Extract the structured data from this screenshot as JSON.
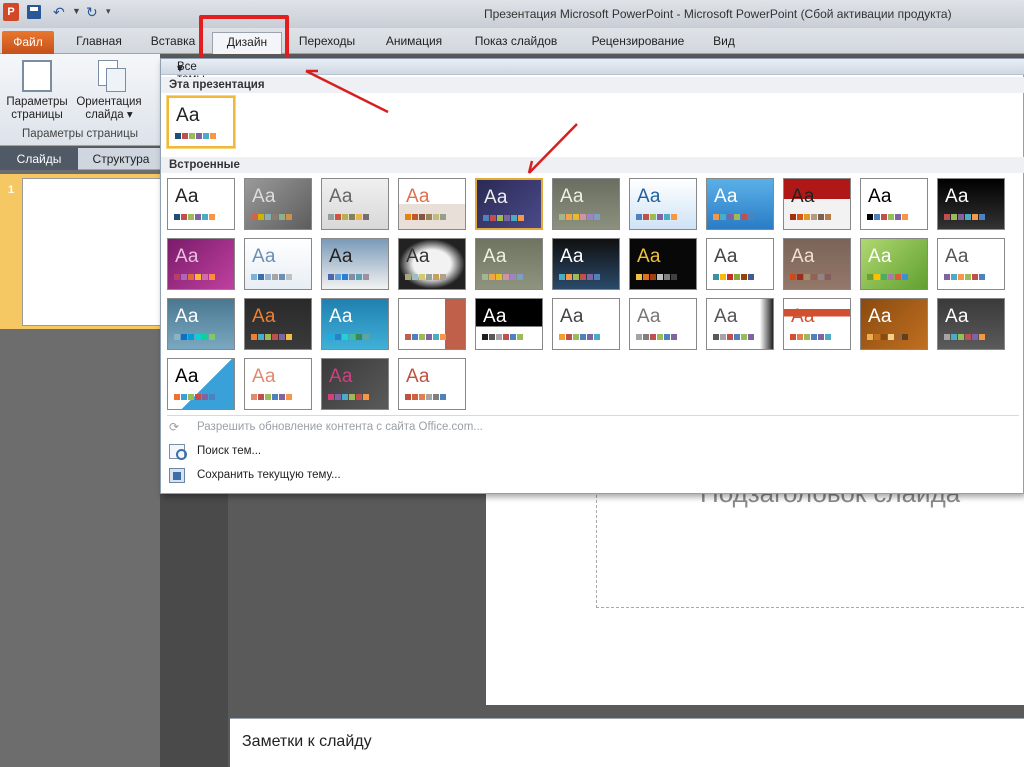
{
  "window": {
    "title": "Презентация Microsoft PowerPoint  -  Microsoft PowerPoint (Сбой активации продукта)",
    "app_icon": "P"
  },
  "tabs": [
    {
      "label": "Файл"
    },
    {
      "label": "Главная"
    },
    {
      "label": "Вставка"
    },
    {
      "label": "Дизайн"
    },
    {
      "label": "Переходы"
    },
    {
      "label": "Анимация"
    },
    {
      "label": "Показ слайдов"
    },
    {
      "label": "Рецензирование"
    },
    {
      "label": "Вид"
    }
  ],
  "ribbon": {
    "page_setup_label": "Параметры страницы",
    "orientation_label": "Ориентация слайда",
    "group_label": "Параметры страницы"
  },
  "pane": {
    "slides_tab": "Слайды",
    "outline_tab": "Структура",
    "slide_number": "1"
  },
  "gallery": {
    "header": "Все темы",
    "this_presentation": "Эта презентация",
    "builtin": "Встроенные",
    "sample_text": "Аа",
    "current_theme": {
      "bg": "#ffffff",
      "fg": "#222222",
      "sw": [
        "#1f4e79",
        "#c0504d",
        "#9bbb59",
        "#8064a2",
        "#4bacc6",
        "#f79646"
      ]
    },
    "themes": [
      {
        "bg": "#ffffff",
        "fg": "#222222",
        "sw": [
          "#1f4e79",
          "#c0504d",
          "#9bbb59",
          "#8064a2",
          "#4bacc6",
          "#f79646"
        ]
      },
      {
        "bg": "linear-gradient(135deg,#9a9a9a,#5d5d5d)",
        "fg": "#dddddd",
        "sw": [
          "#d16349",
          "#ccb400",
          "#8cadae",
          "#8c7b70",
          "#8fb08c",
          "#d19049"
        ]
      },
      {
        "bg": "linear-gradient(#f0f0f0,#d8d8d8)",
        "fg": "#666666",
        "sw": [
          "#93a299",
          "#cf543f",
          "#b5ae53",
          "#848058",
          "#e8b54d",
          "#786c71"
        ]
      },
      {
        "bg": "linear-gradient(#ffffff 50%,#e8e0d8 50%)",
        "fg": "#e07050",
        "sw": [
          "#e48312",
          "#bd582c",
          "#865640",
          "#9b8357",
          "#c2bc80",
          "#94a088"
        ]
      },
      {
        "bg": "linear-gradient(135deg,#2a2a55,#4a4a8a)",
        "fg": "#eeeeee",
        "sw": [
          "#4f81bd",
          "#c0504d",
          "#9bbb59",
          "#8064a2",
          "#4bacc6",
          "#f79646"
        ]
      },
      {
        "bg": "linear-gradient(#6a6e60,#8c907e)",
        "fg": "#f0f0e0",
        "sw": [
          "#a5b592",
          "#f3a447",
          "#e7bc29",
          "#d092a7",
          "#9c85c0",
          "#809ec2"
        ]
      },
      {
        "bg": "linear-gradient(#ffffff,#cfe3f5)",
        "fg": "#2060a0",
        "sw": [
          "#4f81bd",
          "#c0504d",
          "#9bbb59",
          "#8064a2",
          "#4bacc6",
          "#f79646"
        ]
      },
      {
        "bg": "linear-gradient(#5cb0e8,#2a7cc4)",
        "fg": "#ffffff",
        "sw": [
          "#f79646",
          "#4bacc6",
          "#8064a2",
          "#9bbb59",
          "#c0504d",
          "#4f81bd"
        ]
      },
      {
        "bg": "linear-gradient(#b01818 40%,#f2f2f2 40%)",
        "fg": "#222222",
        "sw": [
          "#a5300f",
          "#d55816",
          "#e19825",
          "#b19c7d",
          "#7f5f52",
          "#b27d49"
        ]
      },
      {
        "bg": "#ffffff",
        "fg": "#000000",
        "sw": [
          "#000000",
          "#4f81bd",
          "#c0504d",
          "#9bbb59",
          "#8064a2",
          "#f79646"
        ]
      },
      {
        "bg": "linear-gradient(#000000,#333333)",
        "fg": "#ffffff",
        "sw": [
          "#c0504d",
          "#9bbb59",
          "#8064a2",
          "#4bacc6",
          "#f79646",
          "#4f81bd"
        ]
      },
      {
        "bg": "linear-gradient(135deg,#7a1c6a,#c040a0)",
        "fg": "#e8c0e0",
        "sw": [
          "#b83d68",
          "#ac66bb",
          "#de6c36",
          "#f9b639",
          "#cf6da4",
          "#fa8d3d"
        ]
      },
      {
        "bg": "linear-gradient(#ffffff,#e8eef5)",
        "fg": "#6b8fb5",
        "sw": [
          "#7fb2d3",
          "#3b6fa8",
          "#97b1d1",
          "#a5a5a5",
          "#6b8fb5",
          "#c0c0c0"
        ]
      },
      {
        "bg": "linear-gradient(#7a9ab8,#f2f2f2)",
        "fg": "#222222",
        "sw": [
          "#4a66ac",
          "#629dd1",
          "#297fd5",
          "#7f8fa9",
          "#5aa2ae",
          "#9d90a0"
        ]
      },
      {
        "bg": "radial-gradient(#f2f2f2 40%,#222222 70%)",
        "fg": "#333333",
        "sw": [
          "#a9a57c",
          "#9cbebd",
          "#d2cb6c",
          "#95a39d",
          "#c89f5d",
          "#b1a089"
        ]
      },
      {
        "bg": "linear-gradient(#6e7460,#8e9480)",
        "fg": "#f0f0e0",
        "sw": [
          "#a5b592",
          "#f3a447",
          "#e7bc29",
          "#d092a7",
          "#9c85c0",
          "#809ec2"
        ]
      },
      {
        "bg": "linear-gradient(#101010,#2a4a6a)",
        "fg": "#ffffff",
        "sw": [
          "#4bacc6",
          "#f79646",
          "#9bbb59",
          "#c0504d",
          "#8064a2",
          "#4f81bd"
        ]
      },
      {
        "bg": "#080808",
        "fg": "#f0c040",
        "sw": [
          "#f0c040",
          "#e07020",
          "#a04010",
          "#c0c0c0",
          "#808080",
          "#404040"
        ]
      },
      {
        "bg": "#ffffff",
        "fg": "#444444",
        "sw": [
          "#3891a7",
          "#feb80a",
          "#c32d2e",
          "#84aa33",
          "#964305",
          "#475a8d"
        ]
      },
      {
        "bg": "linear-gradient(#7a6458,#94786a)",
        "fg": "#f0e0d0",
        "sw": [
          "#d34817",
          "#9b2d1f",
          "#a28e6a",
          "#956251",
          "#918485",
          "#855d5d"
        ]
      },
      {
        "bg": "linear-gradient(135deg,#b0d870,#60a030)",
        "fg": "#ffffff",
        "sw": [
          "#6f9f2f",
          "#ffc000",
          "#4ead5b",
          "#ad79a8",
          "#d65e39",
          "#3c8ed7"
        ]
      },
      {
        "bg": "#ffffff",
        "fg": "#555555",
        "sw": [
          "#8064a2",
          "#4bacc6",
          "#f79646",
          "#9bbb59",
          "#c0504d",
          "#4f81bd"
        ]
      },
      {
        "bg": "linear-gradient(#4a7890,#7aa8c0)",
        "fg": "#ffffff",
        "sw": [
          "#88b5c6",
          "#0f6fc6",
          "#009dd9",
          "#0bd0d9",
          "#10cf9b",
          "#7cca62"
        ]
      },
      {
        "bg": "linear-gradient(#2a2a2a,#3a3a3a)",
        "fg": "#f08030",
        "sw": [
          "#f08030",
          "#4bacc6",
          "#9bbb59",
          "#c0504d",
          "#8064a2",
          "#f0c040"
        ]
      },
      {
        "bg": "linear-gradient(#2080b0,#40b0d8)",
        "fg": "#ffffff",
        "sw": [
          "#1cade4",
          "#2683c6",
          "#27ced7",
          "#42ba97",
          "#3e8853",
          "#62a39f"
        ]
      },
      {
        "bg": "linear-gradient(90deg,#ffffff 70%,#c0604a 70%)",
        "fg": "#ffffff",
        "sw": [
          "#c0604a",
          "#4f81bd",
          "#9bbb59",
          "#8064a2",
          "#4bacc6",
          "#f79646"
        ]
      },
      {
        "bg": "linear-gradient(#000000 55%,#ffffff 55%)",
        "fg": "#ffffff",
        "sw": [
          "#1f1f1f",
          "#595959",
          "#a5a5a5",
          "#c0504d",
          "#4f81bd",
          "#9bbb59"
        ]
      },
      {
        "bg": "#ffffff",
        "fg": "#444444",
        "sw": [
          "#f0a030",
          "#c0504d",
          "#9bbb59",
          "#4f81bd",
          "#8064a2",
          "#4bacc6"
        ]
      },
      {
        "bg": "#ffffff",
        "fg": "#777777",
        "sw": [
          "#a5a5a5",
          "#7f7f7f",
          "#c0504d",
          "#9bbb59",
          "#4f81bd",
          "#8064a2"
        ]
      },
      {
        "bg": "linear-gradient(90deg,#ffffff 80%,#222222 100%)",
        "fg": "#555555",
        "sw": [
          "#595959",
          "#a5a5a5",
          "#c0504d",
          "#4f81bd",
          "#9bbb59",
          "#8064a2"
        ]
      },
      {
        "bg": "linear-gradient(#ffffff 20%,#d05030 20%,#d05030 35%,#ffffff 35%)",
        "fg": "#d05030",
        "sw": [
          "#d05030",
          "#e08050",
          "#9bbb59",
          "#4f81bd",
          "#8064a2",
          "#4bacc6"
        ]
      },
      {
        "bg": "linear-gradient(135deg,#8a4a10,#c07020)",
        "fg": "#ffffff",
        "sw": [
          "#e8b050",
          "#c07020",
          "#8a4a10",
          "#f0d090",
          "#a06030",
          "#604020"
        ]
      },
      {
        "bg": "linear-gradient(#3a3a3a,#5a5a5a)",
        "fg": "#ffffff",
        "sw": [
          "#a5a5a5",
          "#4bacc6",
          "#9bbb59",
          "#c0504d",
          "#8064a2",
          "#f79646"
        ]
      },
      {
        "bg": "linear-gradient(135deg,#ffffff 55%,#3aa0d8 55%)",
        "fg": "#000000",
        "sw": [
          "#f07030",
          "#3aa0d8",
          "#9bbb59",
          "#c0504d",
          "#8064a2",
          "#4f81bd"
        ]
      },
      {
        "bg": "#ffffff",
        "fg": "#e08a70",
        "sw": [
          "#e08a70",
          "#c0504d",
          "#9bbb59",
          "#4f81bd",
          "#8064a2",
          "#f79646"
        ]
      },
      {
        "bg": "linear-gradient(135deg,#3a3a3a,#5a5a5a)",
        "fg": "#d04080",
        "sw": [
          "#d04080",
          "#8064a2",
          "#4bacc6",
          "#9bbb59",
          "#c0504d",
          "#f79646"
        ]
      },
      {
        "bg": "#ffffff",
        "fg": "#c05040",
        "sw": [
          "#c05040",
          "#d06040",
          "#e08050",
          "#a5a5a5",
          "#7f7f7f",
          "#4f81bd"
        ]
      }
    ],
    "refresh_label": "Разрешить обновление контента с сайта Office.com...",
    "browse_label": "Поиск тем...",
    "save_label": "Сохранить текущую тему..."
  },
  "slide": {
    "subtitle_placeholder": "Подзаголовок слайда"
  },
  "notes": {
    "placeholder": "Заметки к слайду"
  }
}
